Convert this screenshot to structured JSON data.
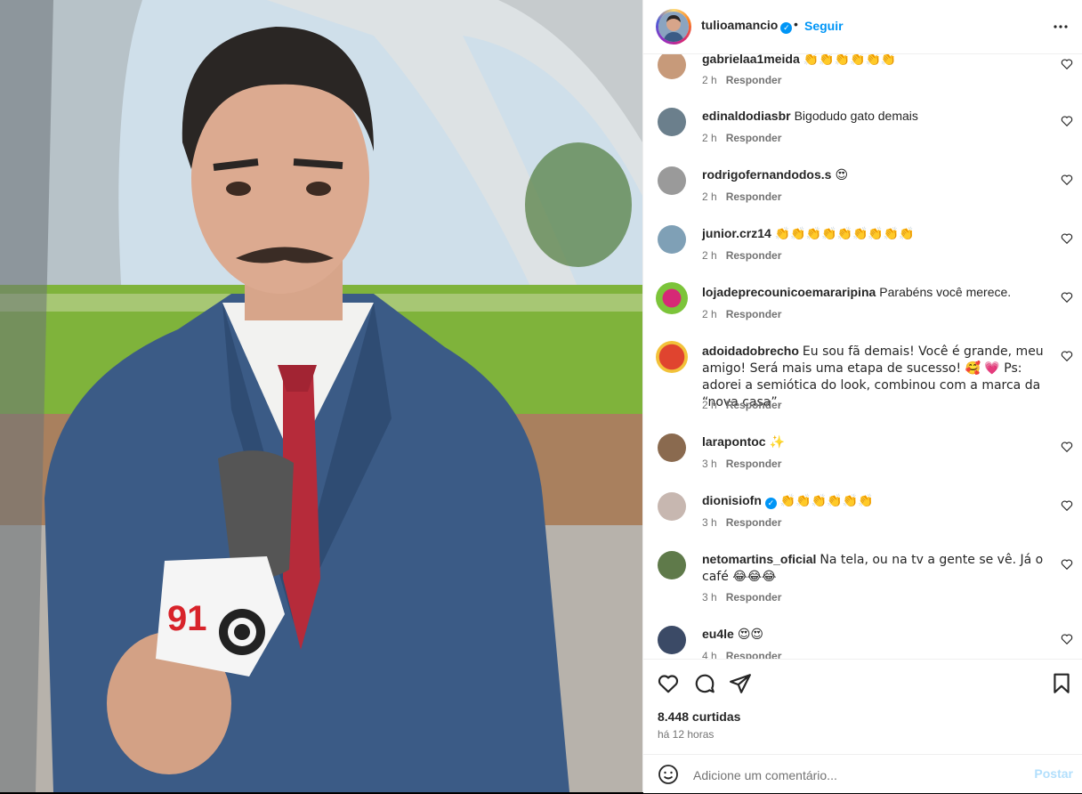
{
  "post": {
    "username": "tulioamancio",
    "verified": true,
    "follow_label": "Seguir",
    "more_icon": "more-horizontal-icon",
    "mic_label_number": "91"
  },
  "comments": [
    {
      "user": "gabrielaa1meida",
      "text": "👏👏👏👏👏👏",
      "time": "2 h",
      "reply": "Responder",
      "verified": false
    },
    {
      "user": "edinaldodiasbr",
      "text": "Bigodudo gato demais",
      "time": "2 h",
      "reply": "Responder",
      "verified": false
    },
    {
      "user": "rodrigofernandodos.s",
      "text": "😍",
      "time": "2 h",
      "reply": "Responder",
      "verified": false
    },
    {
      "user": "junior.crz14",
      "text": "👏👏👏👏👏👏👏👏👏",
      "time": "2 h",
      "reply": "Responder",
      "verified": false
    },
    {
      "user": "lojadeprecounicoemararipina",
      "text": "Parabéns você merece.",
      "time": "2 h",
      "reply": "Responder",
      "verified": false
    },
    {
      "user": "adoidadobrecho",
      "text": "Eu sou fã demais! Você é grande, meu amigo! Será mais uma etapa de sucesso! 🥰 💗 Ps: adorei a semiótica do look, combinou com a marca da “nova casa”.",
      "time": "2 h",
      "reply": "Responder",
      "verified": false
    },
    {
      "user": "larapontoc",
      "text": "✨",
      "time": "3 h",
      "reply": "Responder",
      "verified": false
    },
    {
      "user": "dionisiofn",
      "text": "👏👏👏👏👏👏",
      "time": "3 h",
      "reply": "Responder",
      "verified": true
    },
    {
      "user": "netomartins_oficial",
      "text": "Na tela, ou na tv a gente se vê. Já o café 😂😂😂",
      "time": "3 h",
      "reply": "Responder",
      "verified": false
    },
    {
      "user": "eu4le",
      "text": "😍😍",
      "time": "4 h",
      "reply": "Responder",
      "verified": false
    }
  ],
  "actions": {
    "like_icon": "heart-icon",
    "comment_icon": "comment-icon",
    "share_icon": "share-icon",
    "save_icon": "bookmark-icon",
    "likes_text": "8.448 curtidas",
    "time_ago": "há 12 horas"
  },
  "add_comment": {
    "placeholder": "Adicione um comentário...",
    "post_label": "Postar",
    "emoji_icon": "emoji-icon"
  },
  "colors": {
    "link_blue": "#0095f6",
    "post_disabled": "#b2dffc",
    "muted_text": "#737373"
  }
}
